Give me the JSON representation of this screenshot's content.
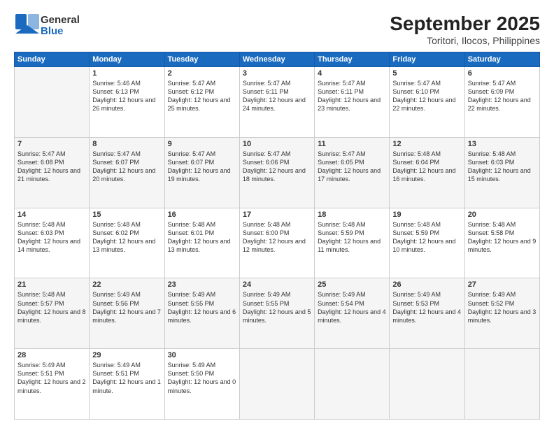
{
  "logo": {
    "general": "General",
    "blue": "Blue"
  },
  "title": "September 2025",
  "subtitle": "Toritori, Ilocos, Philippines",
  "days_header": [
    "Sunday",
    "Monday",
    "Tuesday",
    "Wednesday",
    "Thursday",
    "Friday",
    "Saturday"
  ],
  "weeks": [
    [
      {
        "day": "",
        "sunrise": "",
        "sunset": "",
        "daylight": ""
      },
      {
        "day": "1",
        "sunrise": "Sunrise: 5:46 AM",
        "sunset": "Sunset: 6:13 PM",
        "daylight": "Daylight: 12 hours and 26 minutes."
      },
      {
        "day": "2",
        "sunrise": "Sunrise: 5:47 AM",
        "sunset": "Sunset: 6:12 PM",
        "daylight": "Daylight: 12 hours and 25 minutes."
      },
      {
        "day": "3",
        "sunrise": "Sunrise: 5:47 AM",
        "sunset": "Sunset: 6:11 PM",
        "daylight": "Daylight: 12 hours and 24 minutes."
      },
      {
        "day": "4",
        "sunrise": "Sunrise: 5:47 AM",
        "sunset": "Sunset: 6:11 PM",
        "daylight": "Daylight: 12 hours and 23 minutes."
      },
      {
        "day": "5",
        "sunrise": "Sunrise: 5:47 AM",
        "sunset": "Sunset: 6:10 PM",
        "daylight": "Daylight: 12 hours and 22 minutes."
      },
      {
        "day": "6",
        "sunrise": "Sunrise: 5:47 AM",
        "sunset": "Sunset: 6:09 PM",
        "daylight": "Daylight: 12 hours and 22 minutes."
      }
    ],
    [
      {
        "day": "7",
        "sunrise": "Sunrise: 5:47 AM",
        "sunset": "Sunset: 6:08 PM",
        "daylight": "Daylight: 12 hours and 21 minutes."
      },
      {
        "day": "8",
        "sunrise": "Sunrise: 5:47 AM",
        "sunset": "Sunset: 6:07 PM",
        "daylight": "Daylight: 12 hours and 20 minutes."
      },
      {
        "day": "9",
        "sunrise": "Sunrise: 5:47 AM",
        "sunset": "Sunset: 6:07 PM",
        "daylight": "Daylight: 12 hours and 19 minutes."
      },
      {
        "day": "10",
        "sunrise": "Sunrise: 5:47 AM",
        "sunset": "Sunset: 6:06 PM",
        "daylight": "Daylight: 12 hours and 18 minutes."
      },
      {
        "day": "11",
        "sunrise": "Sunrise: 5:47 AM",
        "sunset": "Sunset: 6:05 PM",
        "daylight": "Daylight: 12 hours and 17 minutes."
      },
      {
        "day": "12",
        "sunrise": "Sunrise: 5:48 AM",
        "sunset": "Sunset: 6:04 PM",
        "daylight": "Daylight: 12 hours and 16 minutes."
      },
      {
        "day": "13",
        "sunrise": "Sunrise: 5:48 AM",
        "sunset": "Sunset: 6:03 PM",
        "daylight": "Daylight: 12 hours and 15 minutes."
      }
    ],
    [
      {
        "day": "14",
        "sunrise": "Sunrise: 5:48 AM",
        "sunset": "Sunset: 6:03 PM",
        "daylight": "Daylight: 12 hours and 14 minutes."
      },
      {
        "day": "15",
        "sunrise": "Sunrise: 5:48 AM",
        "sunset": "Sunset: 6:02 PM",
        "daylight": "Daylight: 12 hours and 13 minutes."
      },
      {
        "day": "16",
        "sunrise": "Sunrise: 5:48 AM",
        "sunset": "Sunset: 6:01 PM",
        "daylight": "Daylight: 12 hours and 13 minutes."
      },
      {
        "day": "17",
        "sunrise": "Sunrise: 5:48 AM",
        "sunset": "Sunset: 6:00 PM",
        "daylight": "Daylight: 12 hours and 12 minutes."
      },
      {
        "day": "18",
        "sunrise": "Sunrise: 5:48 AM",
        "sunset": "Sunset: 5:59 PM",
        "daylight": "Daylight: 12 hours and 11 minutes."
      },
      {
        "day": "19",
        "sunrise": "Sunrise: 5:48 AM",
        "sunset": "Sunset: 5:59 PM",
        "daylight": "Daylight: 12 hours and 10 minutes."
      },
      {
        "day": "20",
        "sunrise": "Sunrise: 5:48 AM",
        "sunset": "Sunset: 5:58 PM",
        "daylight": "Daylight: 12 hours and 9 minutes."
      }
    ],
    [
      {
        "day": "21",
        "sunrise": "Sunrise: 5:48 AM",
        "sunset": "Sunset: 5:57 PM",
        "daylight": "Daylight: 12 hours and 8 minutes."
      },
      {
        "day": "22",
        "sunrise": "Sunrise: 5:49 AM",
        "sunset": "Sunset: 5:56 PM",
        "daylight": "Daylight: 12 hours and 7 minutes."
      },
      {
        "day": "23",
        "sunrise": "Sunrise: 5:49 AM",
        "sunset": "Sunset: 5:55 PM",
        "daylight": "Daylight: 12 hours and 6 minutes."
      },
      {
        "day": "24",
        "sunrise": "Sunrise: 5:49 AM",
        "sunset": "Sunset: 5:55 PM",
        "daylight": "Daylight: 12 hours and 5 minutes."
      },
      {
        "day": "25",
        "sunrise": "Sunrise: 5:49 AM",
        "sunset": "Sunset: 5:54 PM",
        "daylight": "Daylight: 12 hours and 4 minutes."
      },
      {
        "day": "26",
        "sunrise": "Sunrise: 5:49 AM",
        "sunset": "Sunset: 5:53 PM",
        "daylight": "Daylight: 12 hours and 4 minutes."
      },
      {
        "day": "27",
        "sunrise": "Sunrise: 5:49 AM",
        "sunset": "Sunset: 5:52 PM",
        "daylight": "Daylight: 12 hours and 3 minutes."
      }
    ],
    [
      {
        "day": "28",
        "sunrise": "Sunrise: 5:49 AM",
        "sunset": "Sunset: 5:51 PM",
        "daylight": "Daylight: 12 hours and 2 minutes."
      },
      {
        "day": "29",
        "sunrise": "Sunrise: 5:49 AM",
        "sunset": "Sunset: 5:51 PM",
        "daylight": "Daylight: 12 hours and 1 minute."
      },
      {
        "day": "30",
        "sunrise": "Sunrise: 5:49 AM",
        "sunset": "Sunset: 5:50 PM",
        "daylight": "Daylight: 12 hours and 0 minutes."
      },
      {
        "day": "",
        "sunrise": "",
        "sunset": "",
        "daylight": ""
      },
      {
        "day": "",
        "sunrise": "",
        "sunset": "",
        "daylight": ""
      },
      {
        "day": "",
        "sunrise": "",
        "sunset": "",
        "daylight": ""
      },
      {
        "day": "",
        "sunrise": "",
        "sunset": "",
        "daylight": ""
      }
    ]
  ]
}
